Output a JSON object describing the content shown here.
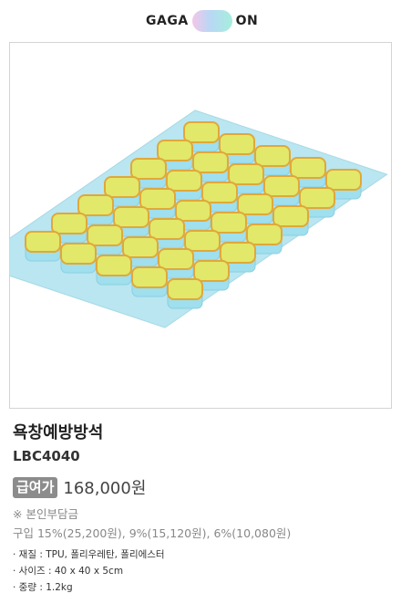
{
  "brand": {
    "left_text": "GAGA",
    "right_text": "ON"
  },
  "product": {
    "name": "욕창예방방석",
    "code": "LBC4040",
    "badge": "급여가",
    "price": "168,000원",
    "note": "※ 본인부담금",
    "copay": "구입 15%(25,200원), 9%(15,120원), 6%(10,080원)",
    "specs": [
      "· 재질 : TPU, 폴리우레탄, 폴리에스터",
      "· 사이즈 : 40 x 40 x 5cm",
      "· 중량 : 1.2kg"
    ]
  },
  "colors": {
    "cell_top": "#e2e86a",
    "cell_rim": "#e0a83a",
    "cell_base": "#9fdfee",
    "badge_bg": "#8c8c8c"
  }
}
